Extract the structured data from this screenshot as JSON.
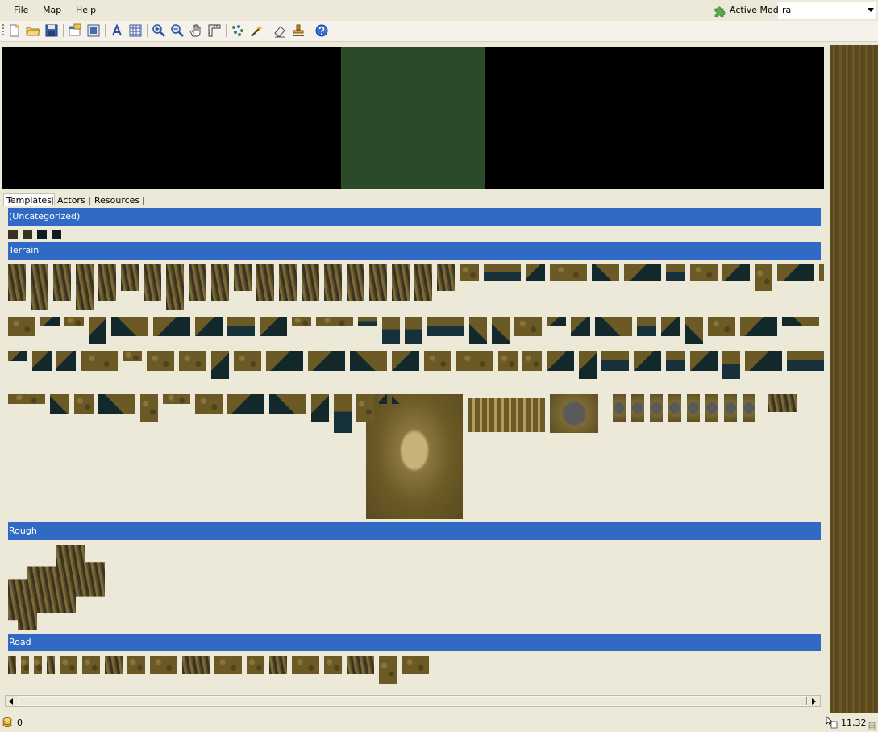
{
  "menu": {
    "file": "File",
    "map": "Map",
    "help": "Help"
  },
  "active_mod": {
    "label": "Active Mod:",
    "value": "ra",
    "icon": "puzzle-icon"
  },
  "toolbar": {
    "buttons": [
      {
        "name": "new-map",
        "icon": "new-document-icon"
      },
      {
        "name": "open",
        "icon": "open-folder-icon"
      },
      {
        "name": "save",
        "icon": "save-disk-icon"
      },
      {
        "name": "properties",
        "icon": "map-properties-icon"
      },
      {
        "name": "resize",
        "icon": "resize-map-icon"
      },
      {
        "name": "show-actor-names",
        "icon": "text-a-icon"
      },
      {
        "name": "show-grid",
        "icon": "grid-icon"
      },
      {
        "name": "zoom-in",
        "icon": "zoom-in-icon"
      },
      {
        "name": "zoom-out",
        "icon": "zoom-out-icon"
      },
      {
        "name": "pan",
        "icon": "hand-icon"
      },
      {
        "name": "ruler",
        "icon": "ruler-icon"
      },
      {
        "name": "random-tiles",
        "icon": "dots-brush-icon"
      },
      {
        "name": "magic-wand",
        "icon": "magic-wand-icon"
      },
      {
        "name": "eraser",
        "icon": "eraser-icon"
      },
      {
        "name": "stamp",
        "icon": "stamp-icon"
      },
      {
        "name": "help",
        "icon": "help-icon"
      }
    ]
  },
  "tabs": {
    "templates": "Templates",
    "actors": "Actors",
    "resources": "Resources"
  },
  "categories": {
    "uncategorized": "(Uncategorized)",
    "terrain": "Terrain",
    "rough": "Rough",
    "road": "Road"
  },
  "status": {
    "count": "0",
    "coords": "11,32"
  },
  "colors": {
    "category_header": "#316ac5",
    "terrain_dirt": "#6b5a26",
    "water": "#13282a",
    "minimap_view": "#2b4a2a"
  }
}
